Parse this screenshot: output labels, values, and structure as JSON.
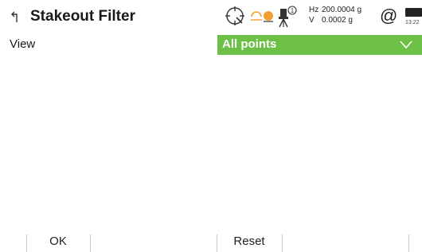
{
  "header": {
    "title": "Stakeout Filter",
    "instrument_id": "1",
    "hz_label": "Hz",
    "hz_value": "200.0004 g",
    "v_label": "V",
    "v_value": "0.0002 g",
    "at_symbol": "@",
    "time": "13:22"
  },
  "icons": {
    "back": "back-arrow-icon",
    "target": "target-search-icon",
    "prism": "prism-icon",
    "instrument": "total-station-icon",
    "connection": "at-icon",
    "battery": "battery-icon",
    "chevron": "chevron-down-icon"
  },
  "form": {
    "view_label": "View",
    "view_value": "All points"
  },
  "softkeys": {
    "ok_label": "OK",
    "reset_label": "Reset"
  },
  "colors": {
    "accent": "#6cc046",
    "prism_accent": "#f0a030"
  }
}
